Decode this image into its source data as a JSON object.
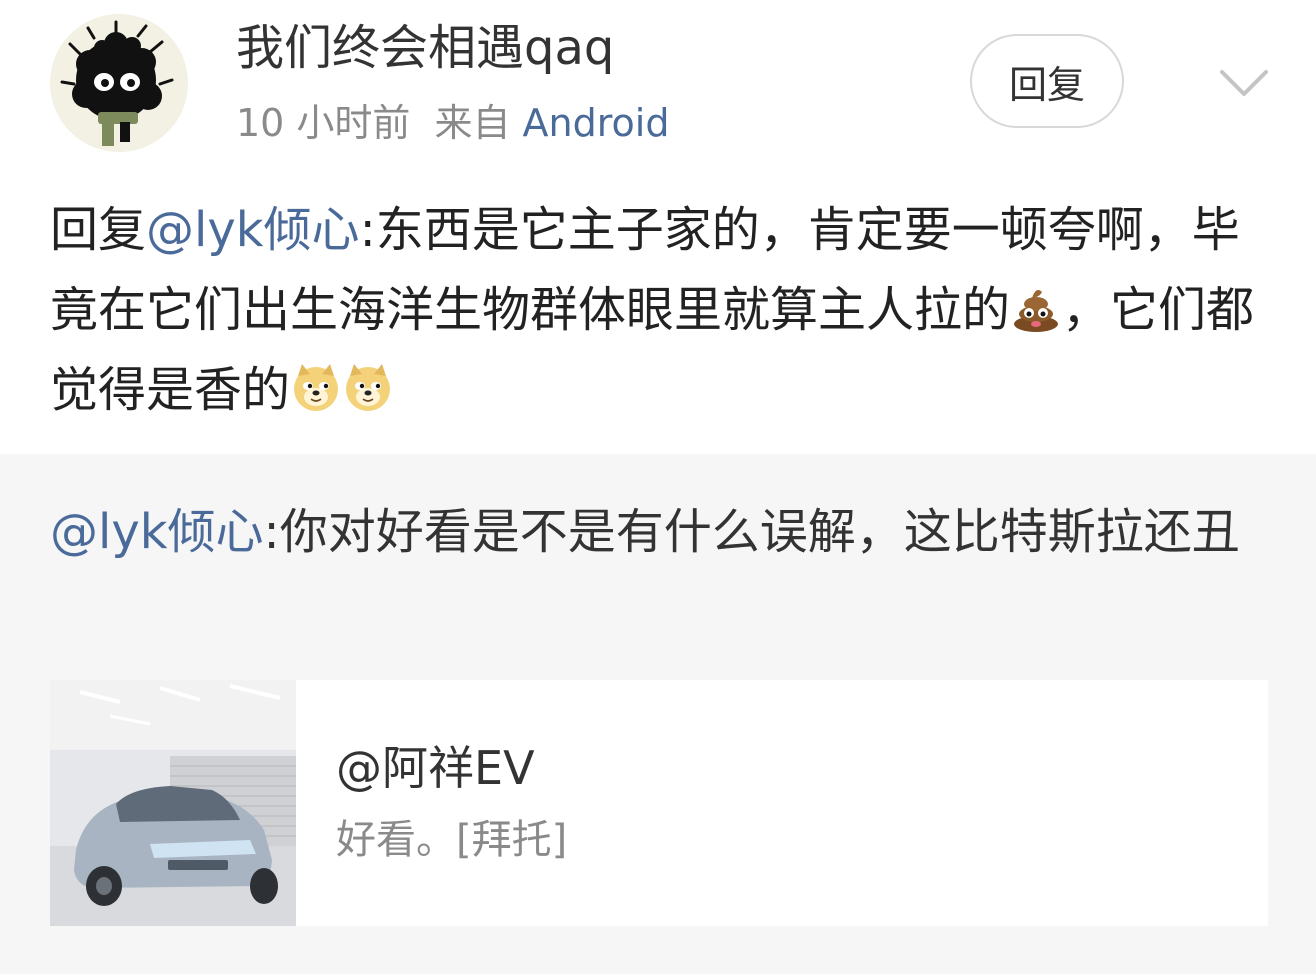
{
  "header": {
    "username": "我们终会相遇qaq",
    "time": "10 小时前",
    "from_label": "来自",
    "source": "Android",
    "reply_label": "回复"
  },
  "comment": {
    "prefix": "回复",
    "mention": "@lyk倾心",
    "text_part1": ":东西是它主子家的，肯定要一顿夸啊，毕竟在它们出生海洋生物群体眼里就算主人拉的",
    "emoji1": "poop-emoji",
    "text_part2": "，它们都觉得是香的",
    "emoji2": "doge-emoji",
    "emoji3": "doge-emoji"
  },
  "quote": {
    "mention": "@lyk倾心",
    "text": ":你对好看是不是有什么误解，这比特斯拉还丑"
  },
  "card": {
    "thumbnail": "car-photo",
    "author": "@阿祥EV",
    "text": "好看。[拜托]"
  },
  "colors": {
    "mention": "#4a6a9a",
    "text": "#222222",
    "meta": "#8a8a8a",
    "quote_bg": "#f6f6f6"
  }
}
